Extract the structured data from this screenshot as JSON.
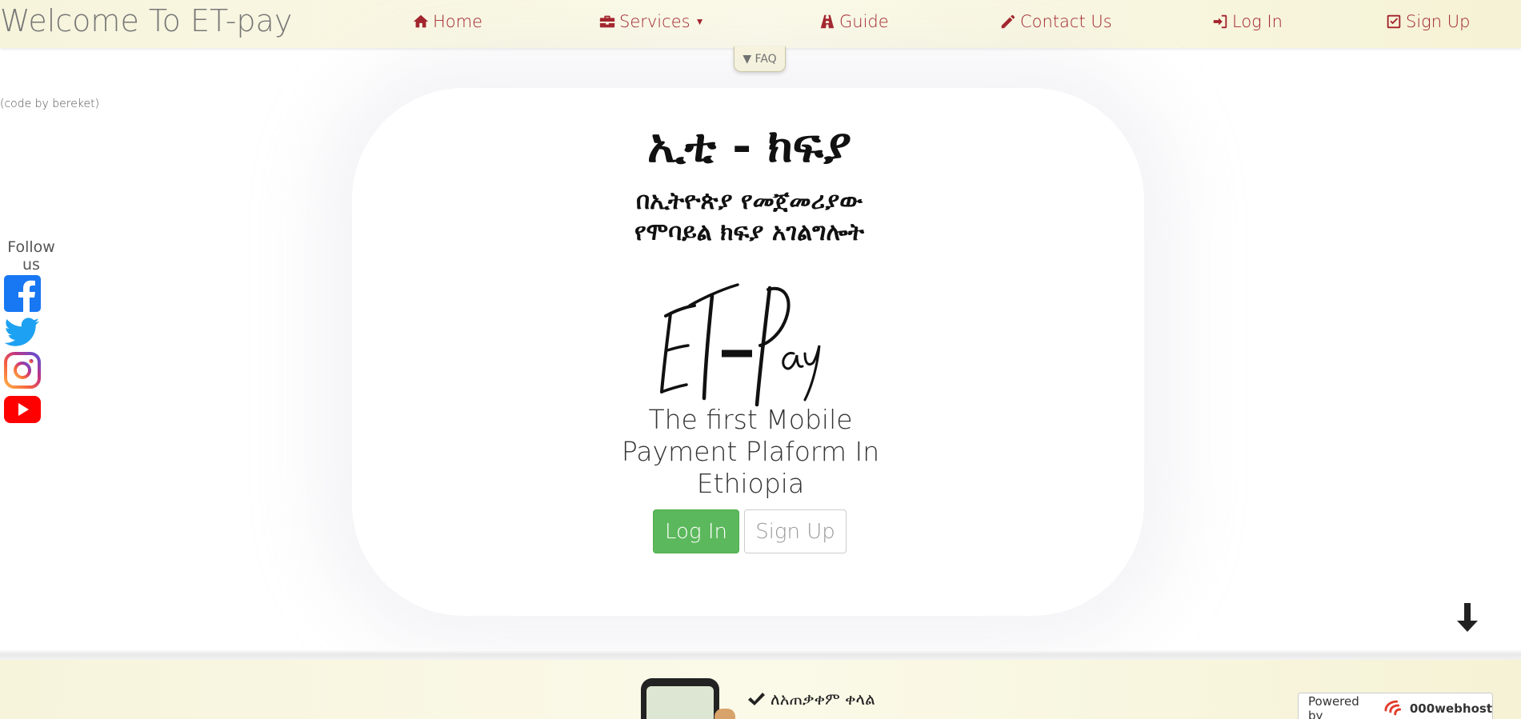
{
  "nav": {
    "brand": "Welcome To ET-pay",
    "home": "Home",
    "services": "Services",
    "guide": "Guide",
    "contact": "Contact Us",
    "login": "Log In",
    "signup": "Sign Up",
    "accent_color": "#a2222a",
    "faq": "▼ FAQ"
  },
  "credit": "(code by bereket)",
  "follow": {
    "label": "Follow us",
    "icons": [
      "facebook-icon",
      "twitter-icon",
      "instagram-icon",
      "youtube-icon"
    ]
  },
  "hero": {
    "title_amharic": "ኢቲ - ክፍያ",
    "subtitle_line1": "በኢትዮጵያ የመጀመሪያው",
    "subtitle_line2": "የሞባይል ክፍያ አገልግሎት",
    "logo_text": "ET-Pay",
    "tagline": "The first Mobile Payment Plaform In Ethiopia",
    "login_button": "Log In",
    "signup_button": "Sign Up",
    "login_color": "#5cb85c"
  },
  "footer": {
    "feature": "ለአጠቃቀም ቀላል",
    "powered_by": "Powered by",
    "host": "000webhost"
  }
}
